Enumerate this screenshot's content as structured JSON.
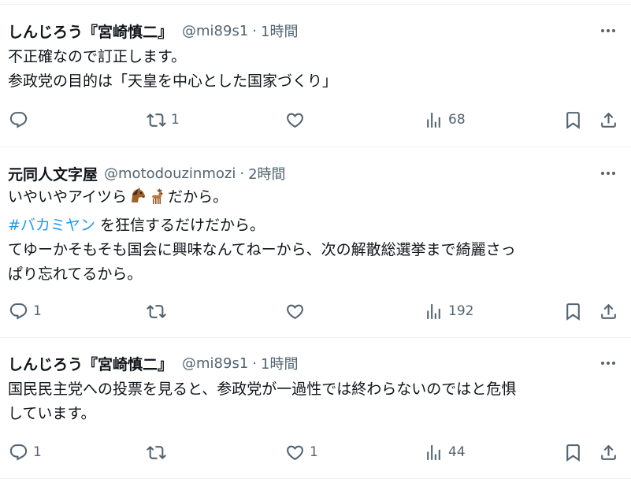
{
  "tweets": [
    {
      "display_name": "しんじろう『宮崎慎二』",
      "handle": "@mi89s1",
      "separator": "·",
      "time": "1時間",
      "lines": [
        "不正確なので訂正します。",
        "参政党の目的は「天皇を中心とした国家づくり」"
      ],
      "reply_count": "",
      "retweet_count": "1",
      "like_count": "",
      "view_count": "68"
    },
    {
      "display_name": "元同人文字屋",
      "handle": "@motodouzinmozi",
      "separator": "·",
      "time": "2時間",
      "line1_before": "いやいやアイツら",
      "emoji": [
        "horse-face-icon",
        "deer-icon"
      ],
      "line1_after": "だから。",
      "hashtag": "#バカミヤン",
      "line2_after": " を狂信するだけだから。",
      "line3": "てゆーかそもそも国会に興味なんてねーから、次の解散総選挙まで綺麗さっ",
      "line4": "ぱり忘れてるから。",
      "reply_count": "1",
      "retweet_count": "",
      "like_count": "",
      "view_count": "192"
    },
    {
      "display_name": "しんじろう『宮崎慎二』",
      "handle": "@mi89s1",
      "separator": "·",
      "time": "1時間",
      "lines": [
        "国民民主党への投票を見ると、参政党が一過性では終わらないのではと危惧",
        "しています。"
      ],
      "reply_count": "1",
      "retweet_count": "",
      "like_count": "1",
      "view_count": "44"
    }
  ],
  "icons": {
    "more": "more-horizontal-icon",
    "reply": "reply-icon",
    "retweet": "retweet-icon",
    "like": "heart-icon",
    "views": "views-chart-icon",
    "bookmark": "bookmark-icon",
    "share": "share-icon"
  },
  "colors": {
    "text": "#0f1419",
    "secondary": "#536471",
    "link": "#1d9bf0",
    "divider": "#eff3f4"
  }
}
